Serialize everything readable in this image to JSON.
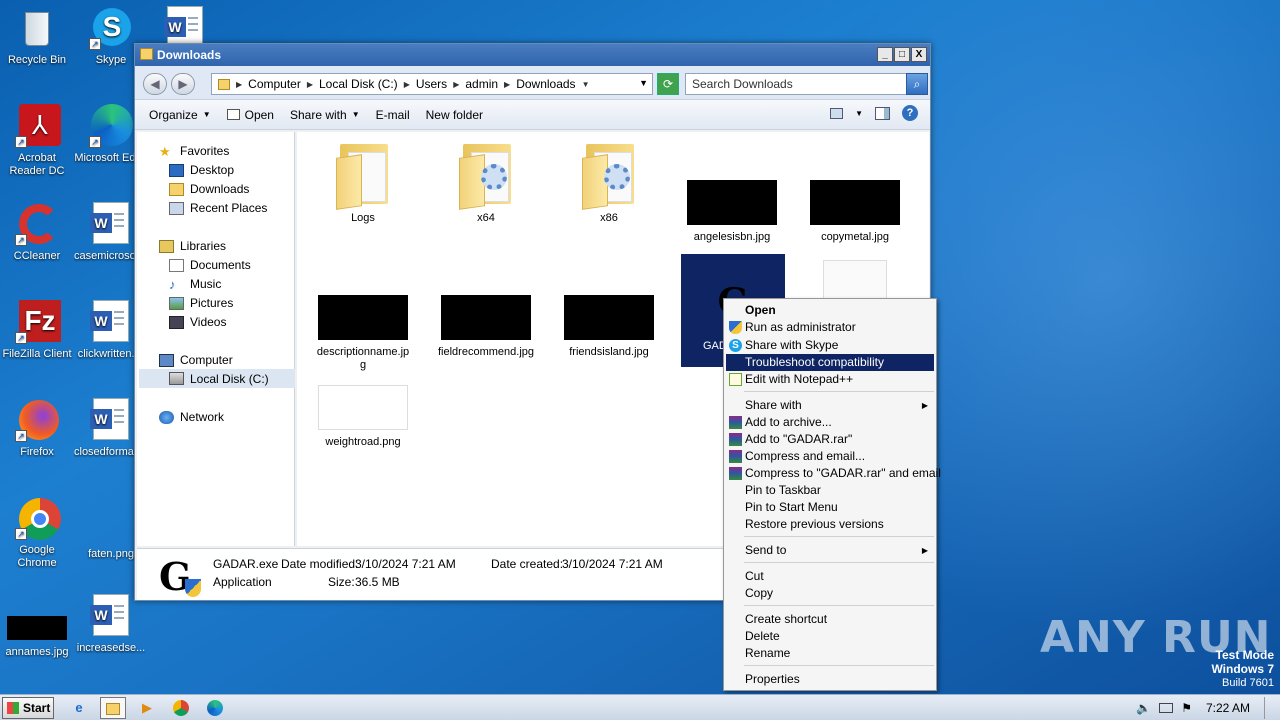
{
  "desktop": {
    "icons": [
      {
        "label": "Recycle Bin",
        "icon": "recycle-bin-icon"
      },
      {
        "label": "Skype",
        "icon": "skype-icon"
      },
      {
        "label": "Acrobat Reader DC",
        "icon": "acrobat-icon"
      },
      {
        "label": "Microsoft Edge",
        "icon": "edge-icon"
      },
      {
        "label": "CCleaner",
        "icon": "ccleaner-icon"
      },
      {
        "label": "casemicrosoft.rtf",
        "icon": "word-doc-icon"
      },
      {
        "label": "FileZilla Client",
        "icon": "filezilla-icon"
      },
      {
        "label": "clickwritten.rtf",
        "icon": "word-doc-icon"
      },
      {
        "label": "Firefox",
        "icon": "firefox-icon"
      },
      {
        "label": "closedformat.rtf",
        "icon": "word-doc-icon"
      },
      {
        "label": "Google Chrome",
        "icon": "chrome-icon"
      },
      {
        "label": "faten.png",
        "icon": "image-icon"
      },
      {
        "label": "annames.jpg",
        "icon": "image-icon"
      },
      {
        "label": "increasedse...",
        "icon": "word-doc-icon"
      }
    ]
  },
  "window": {
    "title": "Downloads",
    "buttons": {
      "minimize": "_",
      "maximize": "□",
      "close": "X"
    },
    "breadcrumb": [
      "Computer",
      "Local Disk (C:)",
      "Users",
      "admin",
      "Downloads"
    ],
    "search_placeholder": "Search Downloads",
    "toolbar": {
      "organize": "Organize",
      "open": "Open",
      "share_with": "Share with",
      "email": "E-mail",
      "new_folder": "New folder"
    },
    "nav": {
      "favorites": "Favorites",
      "desktop": "Desktop",
      "downloads": "Downloads",
      "recent": "Recent Places",
      "libraries": "Libraries",
      "documents": "Documents",
      "music": "Music",
      "pictures": "Pictures",
      "videos": "Videos",
      "computer": "Computer",
      "local_disk": "Local Disk (C:)",
      "network": "Network"
    },
    "files": {
      "logs": "Logs",
      "x64": "x64",
      "x86": "x86",
      "angelesisbn": "angelesisbn.jpg",
      "copymetal": "copymetal.jpg",
      "gadar": "GAD",
      "descriptionname": "descriptionname.jpg",
      "fieldrecommend": "fieldrecommend.jpg",
      "friendsisland": "friendsisland.jpg",
      "weightroad": "weightroad.png"
    },
    "details": {
      "name": "GADAR.exe",
      "type": "Application",
      "modified_label": "Date modified:",
      "modified": "3/10/2024 7:21 AM",
      "size_label": "Size:",
      "size": "36.5 MB",
      "created_label": "Date created:",
      "created": "3/10/2024 7:21 AM"
    }
  },
  "context_menu": {
    "open": "Open",
    "run_admin": "Run as administrator",
    "share_skype": "Share with Skype",
    "troubleshoot": "Troubleshoot compatibility",
    "notepad": "Edit with Notepad++",
    "share_with": "Share with",
    "add_archive": "Add to archive...",
    "add_rar": "Add to \"GADAR.rar\"",
    "compress_email": "Compress and email...",
    "compress_rar_email": "Compress to \"GADAR.rar\" and email",
    "pin_taskbar": "Pin to Taskbar",
    "pin_start": "Pin to Start Menu",
    "restore": "Restore previous versions",
    "send_to": "Send to",
    "cut": "Cut",
    "copy": "Copy",
    "create_shortcut": "Create shortcut",
    "delete": "Delete",
    "rename": "Rename",
    "properties": "Properties"
  },
  "taskbar": {
    "start": "Start",
    "clock": "7:22 AM"
  },
  "watermark": {
    "text": "ANY RUN",
    "test_mode": "Test Mode",
    "os": "Windows 7",
    "build": "Build 7601"
  },
  "colors": {
    "selection": "#0f2462",
    "desktop": "#1a73c4"
  }
}
